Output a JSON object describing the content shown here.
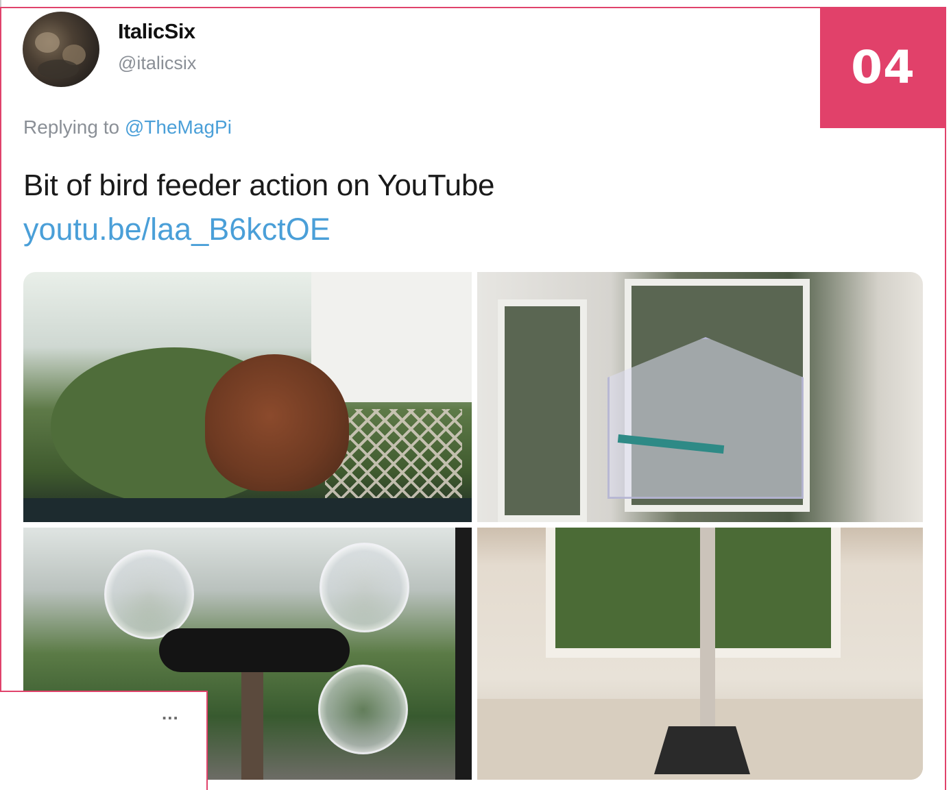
{
  "tweet": {
    "display_name": "ItalicSix",
    "handle": "@italicsix",
    "replying_prefix": "Replying to ",
    "replying_handle": "@TheMagPi",
    "text": "Bit of bird feeder action on YouTube",
    "link": "youtu.be/laa_B6kctOE",
    "more_label": "..."
  },
  "badge": {
    "number": "04",
    "color": "#e1416a"
  },
  "colors": {
    "accent": "#e0436b",
    "link": "#4a9fd8"
  },
  "icons": {
    "avatar": "avatar-icon",
    "more": "more-dots-icon"
  }
}
